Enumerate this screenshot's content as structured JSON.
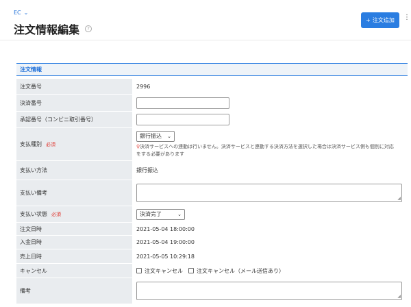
{
  "breadcrumb": {
    "label": "EC"
  },
  "page": {
    "title": "注文情報編集"
  },
  "toolbar": {
    "add_label": "注文追加"
  },
  "section": {
    "title": "注文情報"
  },
  "fields": {
    "order_number": {
      "label": "注文番号",
      "value": "2996"
    },
    "payment_number": {
      "label": "決済番号",
      "value": ""
    },
    "approval_number": {
      "label": "承認番号（コンビニ取引番号）",
      "value": ""
    },
    "payment_type": {
      "label": "支払種別",
      "required": "必須",
      "selected": "銀行振込",
      "note_line1": "決済サービスへの連動は行いません。決済サービスと連動する決済方法を選択した場合は決済サービス側も個別に対応",
      "note_line2": "をする必要があります"
    },
    "payment_method": {
      "label": "支払い方法",
      "value": "銀行振込"
    },
    "payment_remarks": {
      "label": "支払い備考",
      "value": ""
    },
    "payment_status": {
      "label": "支払い状態",
      "required": "必須",
      "selected": "決済完了"
    },
    "order_datetime": {
      "label": "注文日時",
      "value": "2021-05-04 18:00:00"
    },
    "deposit_datetime": {
      "label": "入金日時",
      "value": "2021-05-04 19:00:00"
    },
    "sales_datetime": {
      "label": "売上日時",
      "value": "2021-05-05 10:29:18"
    },
    "cancel": {
      "label": "キャンセル",
      "option1": "注文キャンセル",
      "option2": "注文キャンセル（メール送信あり）"
    },
    "remarks": {
      "label": "備考",
      "value": ""
    }
  },
  "colors": {
    "accent": "#2a7de1",
    "required": "#e0342d",
    "label_bg": "#e9ecef"
  }
}
